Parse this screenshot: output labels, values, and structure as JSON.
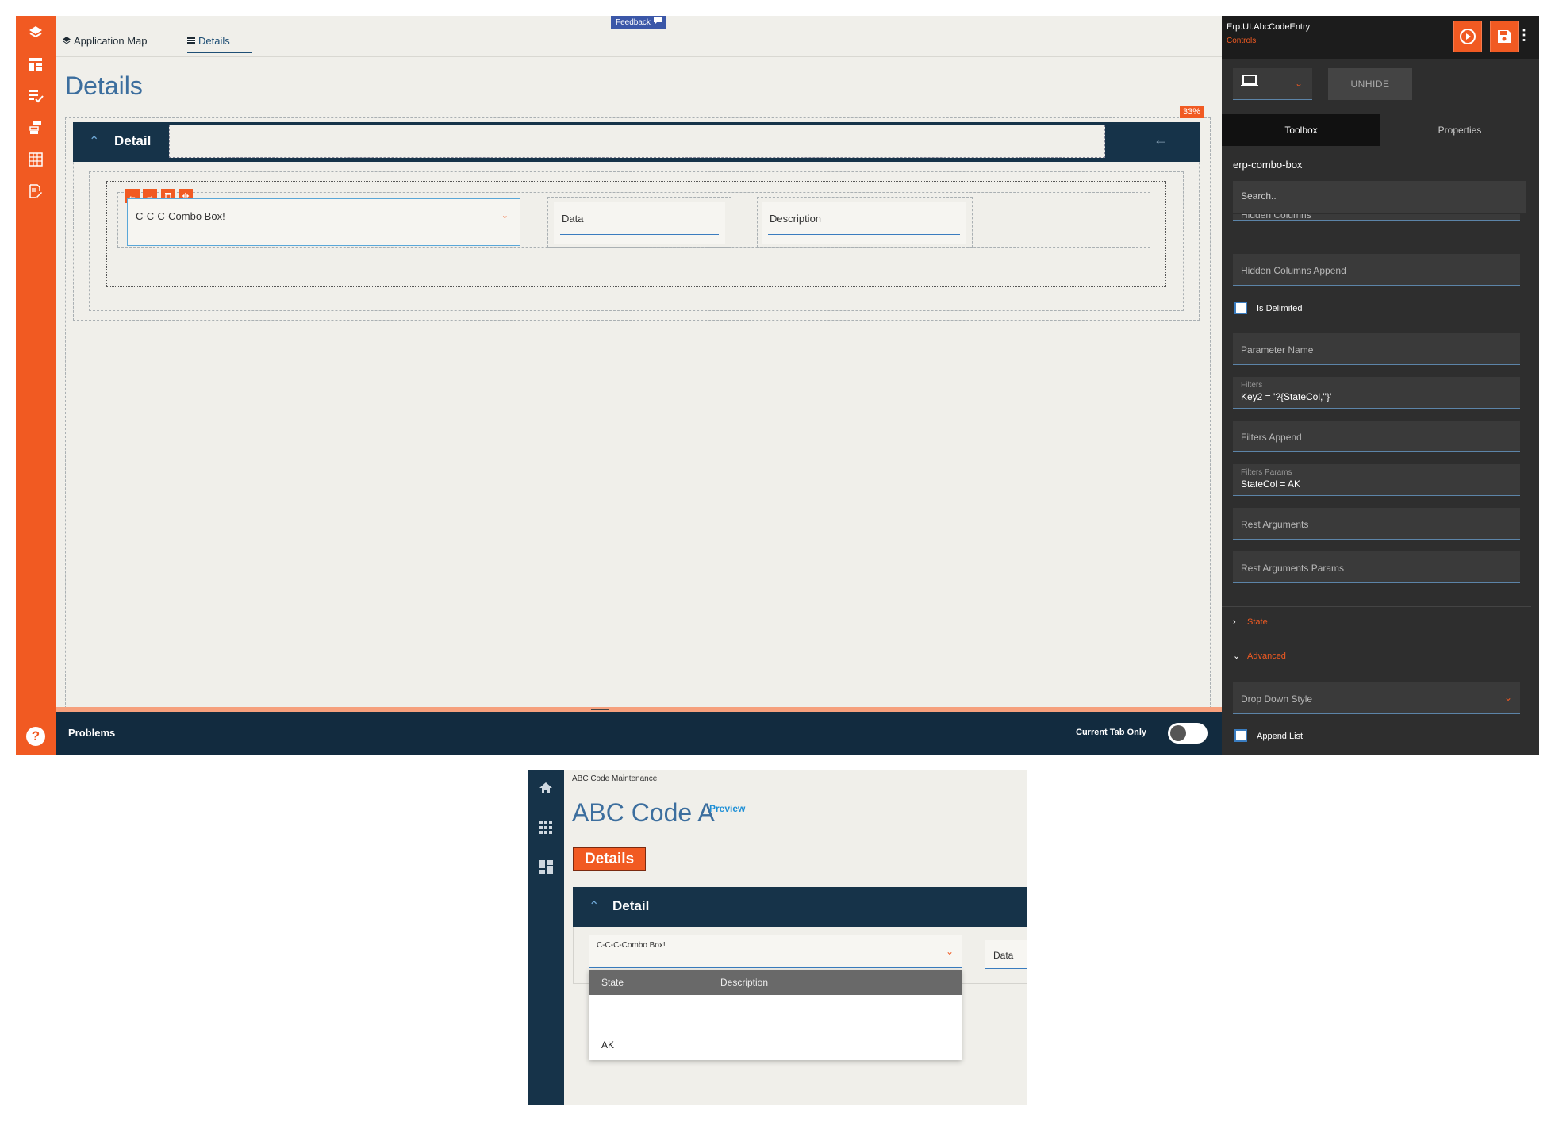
{
  "designer": {
    "tabs": [
      {
        "label": "Application Map",
        "icon": "layers-icon"
      },
      {
        "label": "Details",
        "icon": "table-icon"
      }
    ],
    "feedback_label": "Feedback",
    "page_title": "Details",
    "percent_badge": "33%",
    "detail_label": "Detail",
    "fields": {
      "combo": "C-C-C-Combo Box!",
      "data": "Data",
      "description": "Description"
    },
    "rail_icons": [
      "layers-icon",
      "layout-icon",
      "checklist-icon",
      "flow-icon",
      "grid-icon",
      "edit-doc-icon",
      "help-icon"
    ],
    "problems": {
      "title": "Problems",
      "toggle_label": "Current Tab Only"
    }
  },
  "right_panel": {
    "header_title": "Erp.UI.AbcCodeEntry",
    "header_subtitle": "Controls",
    "unhide_label": "UNHIDE",
    "tabs": [
      "Toolbox",
      "Properties"
    ],
    "component": "erp-combo-box",
    "search_placeholder": "Search..",
    "cut_off_label": "Hidden Columns",
    "properties": {
      "hidden_columns_append": "Hidden Columns Append",
      "is_delimited": "Is Delimited",
      "parameter_name": "Parameter Name",
      "filters_label": "Filters",
      "filters_value": "Key2 = '?{StateCol,''}'",
      "filters_append": "Filters Append",
      "filters_params_label": "Filters Params",
      "filters_params_value": "StateCol = AK",
      "rest_arguments": "Rest Arguments",
      "rest_arguments_params": "Rest Arguments Params",
      "drop_down_style": "Drop Down Style",
      "append_list": "Append List"
    },
    "sections": {
      "state": "State",
      "advanced": "Advanced"
    }
  },
  "preview": {
    "breadcrumb": "ABC Code Maintenance",
    "title": "ABC Code A",
    "preview_link": "Preview",
    "details_button": "Details",
    "detail_label": "Detail",
    "combo_label": "C-C-C-Combo Box!",
    "data_label": "Data",
    "dropdown": {
      "columns": [
        "State",
        "Description"
      ],
      "rows": [
        "AK"
      ]
    }
  }
}
